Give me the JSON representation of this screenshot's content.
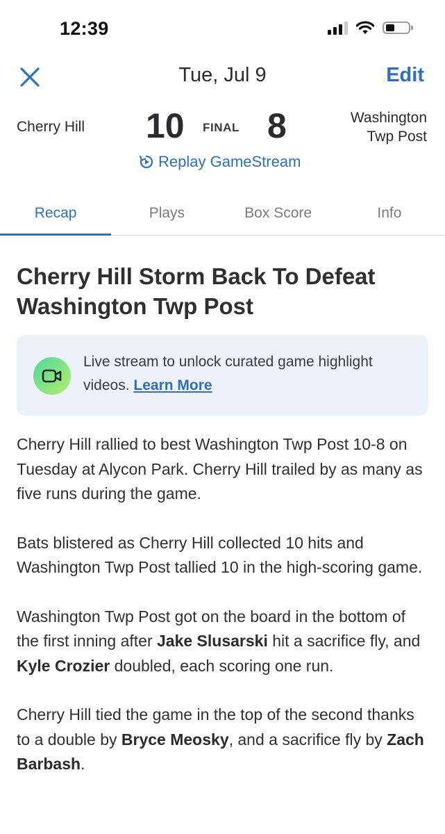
{
  "status_bar": {
    "time": "12:39"
  },
  "nav": {
    "date": "Tue, Jul 9",
    "edit_label": "Edit"
  },
  "scoreboard": {
    "home_team": "Cherry Hill",
    "home_score": "10",
    "status": "FINAL",
    "away_score": "8",
    "away_team_line1": "Washington",
    "away_team_line2": "Twp Post",
    "replay_label": "Replay GameStream"
  },
  "tabs": [
    {
      "label": "Recap",
      "active": true
    },
    {
      "label": "Plays",
      "active": false
    },
    {
      "label": "Box Score",
      "active": false
    },
    {
      "label": "Info",
      "active": false
    }
  ],
  "recap": {
    "headline": "Cherry Hill Storm Back To Defeat Washington Twp Post",
    "promo": {
      "text": "Live stream to unlock curated game highlight videos.",
      "link": "Learn More"
    },
    "p1": "Cherry Hill rallied to best Washington Twp Post 10-8 on Tuesday at Alycon Park. Cherry Hill trailed by as many as five runs during the game.",
    "p2": "Bats blistered as Cherry Hill collected 10 hits and Washington Twp Post tallied 10 in the high-scoring game.",
    "p3": {
      "a": "Washington Twp Post got on the board in the bottom of the first inning after ",
      "player1": "Jake Slusarski",
      "b": " hit a sacrifice fly, and ",
      "player2": "Kyle Crozier",
      "c": " doubled, each scoring one run."
    },
    "p4": {
      "a": "Cherry Hill tied the game in the top of the second thanks to a double by ",
      "player1": "Bryce Meosky",
      "b": ", and a sacrifice fly by ",
      "player2": "Zach Barbash",
      "c": "."
    }
  },
  "colors": {
    "accent": "#2f6fbb",
    "text": "#2b2b2f",
    "promo_bg": "#edf2f8"
  },
  "icons": [
    "close-icon",
    "replay-icon",
    "video-camera-icon",
    "signal-icon",
    "wifi-icon",
    "battery-icon"
  ]
}
